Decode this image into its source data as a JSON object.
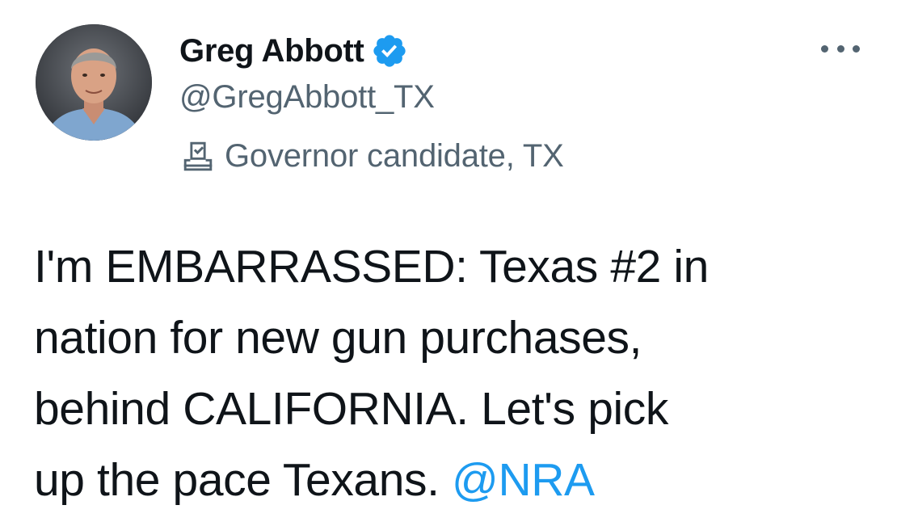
{
  "author": {
    "display_name": "Greg Abbott",
    "handle": "@GregAbbott_TX",
    "verified": true,
    "label": "Governor candidate, TX"
  },
  "icons": {
    "verified": "verified-badge-icon",
    "label": "ballot-box-icon",
    "more": "more-options-icon"
  },
  "tweet": {
    "lines": [
      "I'm EMBARRASSED: Texas #2 in",
      "nation for new gun purchases,",
      "behind CALIFORNIA. Let's pick",
      "up the pace Texans. "
    ],
    "mention": "@NRA"
  },
  "colors": {
    "text": "#0f1419",
    "secondary": "#536471",
    "accent": "#1d9bf0"
  }
}
